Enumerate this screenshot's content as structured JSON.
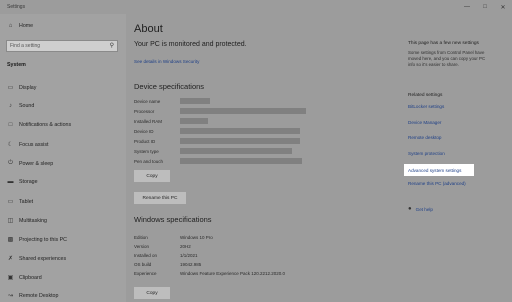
{
  "window": {
    "title": "Settings",
    "controls": {
      "minimize": "—",
      "maximize": "□",
      "close": "✕"
    }
  },
  "sidebar": {
    "home": {
      "label": "Home",
      "icon": "home-icon"
    },
    "search": {
      "placeholder": "Find a setting"
    },
    "section_title": "System",
    "items": [
      {
        "label": "Display",
        "icon": "display-icon"
      },
      {
        "label": "Sound",
        "icon": "sound-icon"
      },
      {
        "label": "Notifications & actions",
        "icon": "notifications-icon"
      },
      {
        "label": "Focus assist",
        "icon": "focus-assist-icon"
      },
      {
        "label": "Power & sleep",
        "icon": "power-icon"
      },
      {
        "label": "Storage",
        "icon": "storage-icon"
      },
      {
        "label": "Tablet",
        "icon": "tablet-icon"
      },
      {
        "label": "Multitasking",
        "icon": "multitasking-icon"
      },
      {
        "label": "Projecting to this PC",
        "icon": "projecting-icon"
      },
      {
        "label": "Shared experiences",
        "icon": "shared-experiences-icon"
      },
      {
        "label": "Clipboard",
        "icon": "clipboard-icon"
      },
      {
        "label": "Remote Desktop",
        "icon": "remote-desktop-icon"
      }
    ]
  },
  "main": {
    "title": "About",
    "protection_status": "Your PC is monitored and protected.",
    "security_link": "See details in Windows Security",
    "device_specs": {
      "heading": "Device specifications",
      "rows": [
        {
          "label": "Device name"
        },
        {
          "label": "Processor"
        },
        {
          "label": "Installed RAM"
        },
        {
          "label": "Device ID"
        },
        {
          "label": "Product ID"
        },
        {
          "label": "System type"
        },
        {
          "label": "Pen and touch"
        }
      ],
      "copy_button": "Copy",
      "rename_button": "Rename this PC"
    },
    "windows_specs": {
      "heading": "Windows specifications",
      "rows": [
        {
          "label": "Edition",
          "value": "Windows 10 Pro"
        },
        {
          "label": "Version",
          "value": "20H2"
        },
        {
          "label": "Installed on",
          "value": "1/1/2021"
        },
        {
          "label": "OS build",
          "value": "19042.985"
        },
        {
          "label": "Experience",
          "value": "Windows Feature Experience Pack 120.2212.2020.0"
        }
      ],
      "copy_button": "Copy"
    }
  },
  "right_panel": {
    "new_settings_heading": "This page has a few new settings",
    "new_settings_text": "Some settings from Control Panel have moved here, and you can copy your PC info so it's easier to share.",
    "related_heading": "Related settings",
    "links": [
      "BitLocker settings",
      "Device Manager",
      "Remote desktop",
      "System protection",
      "Advanced system settings",
      "Rename this PC (advanced)"
    ],
    "help": {
      "label": "Get help",
      "icon": "help-icon"
    }
  }
}
